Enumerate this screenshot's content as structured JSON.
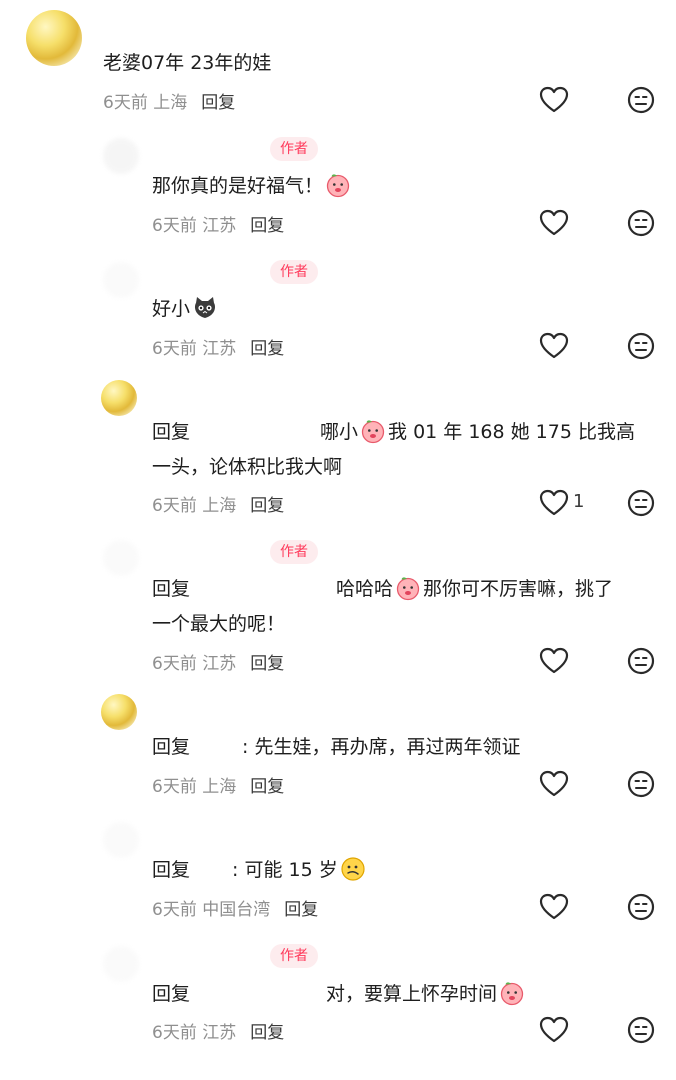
{
  "comments": [
    {
      "text": "老婆07年 23年的娃",
      "location": "6天前 上海",
      "reply": "回复"
    },
    {
      "tag": "作者",
      "text": "那你真的是好福气！",
      "location": "6天前 江苏",
      "reply": "回复"
    },
    {
      "tag": "作者",
      "text": "好小",
      "location": "6天前 江苏",
      "reply": "回复"
    },
    {
      "prefix": "回复",
      "text": "哪小",
      "text2": "我 01 年 168 她 175 比我高",
      "line2": "一头，论体积比我大啊",
      "location": "6天前 上海",
      "reply": "回复",
      "likes": "1"
    },
    {
      "tag": "作者",
      "prefix": "回复",
      "text": "哈哈哈",
      "text2": "那你可不厉害嘛，挑了",
      "line2": "一个最大的呢！",
      "location": "6天前 江苏",
      "reply": "回复"
    },
    {
      "prefix": "回复",
      "text": "先生娃，再办席，再过两年领证",
      "location": "6天前 上海",
      "reply": "回复"
    },
    {
      "prefix": "回复",
      "text": "可能 15 岁",
      "location": "6天前 中国台湾",
      "reply": "回复"
    },
    {
      "tag": "作者",
      "prefix": "回复",
      "text": "对，要算上怀孕时间",
      "location": "6天前 江苏",
      "reply": "回复"
    }
  ],
  "icons": {
    "like": "heart-outline-icon",
    "dislike": "neutral-face-icon",
    "emoji": "peach-emoji-icon",
    "cat": "cat-emoji-icon"
  }
}
